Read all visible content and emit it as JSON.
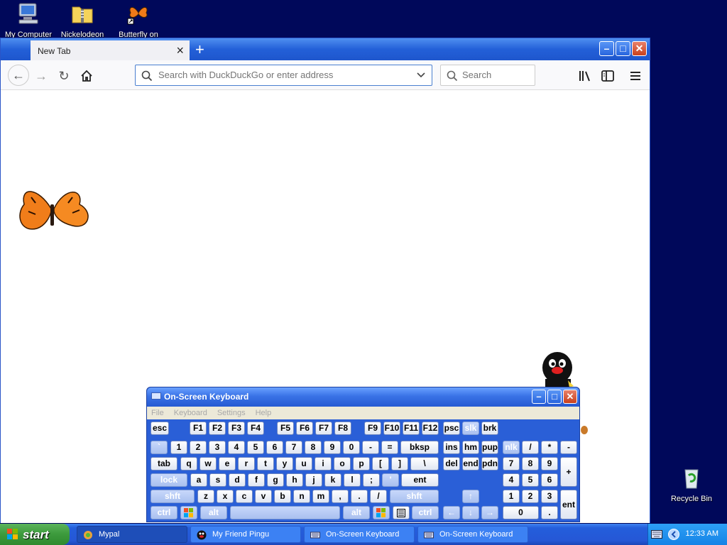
{
  "desktop": {
    "icons": [
      {
        "label": "My Computer"
      },
      {
        "label": "Nickelodeon"
      },
      {
        "label": "Butterfly on"
      },
      {
        "label": "Recycle Bin"
      }
    ]
  },
  "browser": {
    "tab_title": "New Tab",
    "new_tab_label": "+",
    "url_placeholder": "Search with DuckDuckGo or enter address",
    "search_placeholder": "Search"
  },
  "osk": {
    "title": "On-Screen Keyboard",
    "menu": [
      "File",
      "Keyboard",
      "Settings",
      "Help"
    ],
    "keys": {
      "esc": "esc",
      "f1": "F1",
      "f2": "F2",
      "f3": "F3",
      "f4": "F4",
      "f5": "F5",
      "f6": "F6",
      "f7": "F7",
      "f8": "F8",
      "f9": "F9",
      "f10": "F10",
      "f11": "F11",
      "f12": "F12",
      "psc": "psc",
      "slk": "slk",
      "brk": "brk",
      "grave": "`",
      "n1": "1",
      "n2": "2",
      "n3": "3",
      "n4": "4",
      "n5": "5",
      "n6": "6",
      "n7": "7",
      "n8": "8",
      "n9": "9",
      "n0": "0",
      "minus": "-",
      "equals": "=",
      "bksp": "bksp",
      "ins": "ins",
      "hm": "hm",
      "pup": "pup",
      "nlk": "nlk",
      "kp_div": "/",
      "kp_mul": "*",
      "kp_sub": "-",
      "tab": "tab",
      "q": "q",
      "w": "w",
      "e": "e",
      "r": "r",
      "t": "t",
      "y": "y",
      "u": "u",
      "i": "i",
      "o": "o",
      "p": "p",
      "lbr": "[",
      "rbr": "]",
      "bslash": "\\",
      "del": "del",
      "end": "end",
      "pdn": "pdn",
      "kp7": "7",
      "kp8": "8",
      "kp9": "9",
      "kp_add": "+",
      "lock": "lock",
      "a": "a",
      "s": "s",
      "d": "d",
      "f": "f",
      "g": "g",
      "h": "h",
      "j": "j",
      "k": "k",
      "l": "l",
      "semi": ";",
      "quote": "'",
      "ent": "ent",
      "kp4": "4",
      "kp5": "5",
      "kp6": "6",
      "lshft": "shft",
      "z": "z",
      "x": "x",
      "c": "c",
      "v": "v",
      "b": "b",
      "n": "n",
      "m": "m",
      "comma": ",",
      "period": ".",
      "slash": "/",
      "rshft": "shft",
      "up": "↑",
      "kp1": "1",
      "kp2": "2",
      "kp3": "3",
      "kp_ent": "ent",
      "lctrl": "ctrl",
      "lalt": "alt",
      "ralt": "alt",
      "rctrl": "ctrl",
      "left": "←",
      "down": "↓",
      "right": "→",
      "kp0": "0",
      "kp_dot": "."
    }
  },
  "taskbar": {
    "start_label": "start",
    "tasks": [
      {
        "label": "Mypal"
      },
      {
        "label": "My Friend Pingu"
      },
      {
        "label": "On-Screen Keyboard"
      },
      {
        "label": "On-Screen Keyboard"
      }
    ],
    "clock": "12:33 AM"
  },
  "colors": {
    "desktop_bg": "#00085a",
    "xp_blue": "#245edb",
    "start_green": "#3c9a3c"
  }
}
